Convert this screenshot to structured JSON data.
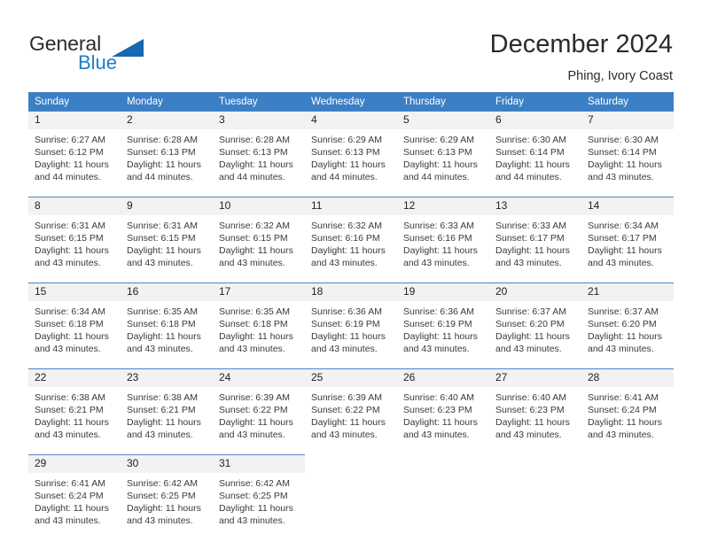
{
  "brand": {
    "name_top": "General",
    "name_bottom": "Blue",
    "triangle_color": "#1669b0",
    "blue_color": "#1f7cc4"
  },
  "header": {
    "title": "December 2024",
    "subtitle": "Phing, Ivory Coast"
  },
  "theme": {
    "header_bg": "#3b7fc4",
    "daynum_bg": "#f2f2f2",
    "row_border": "#4a86c5"
  },
  "calendar": {
    "weekday_headers": [
      "Sunday",
      "Monday",
      "Tuesday",
      "Wednesday",
      "Thursday",
      "Friday",
      "Saturday"
    ],
    "weeks": [
      [
        {
          "day": "1",
          "sunrise": "Sunrise: 6:27 AM",
          "sunset": "Sunset: 6:12 PM",
          "daylight1": "Daylight: 11 hours",
          "daylight2": "and 44 minutes."
        },
        {
          "day": "2",
          "sunrise": "Sunrise: 6:28 AM",
          "sunset": "Sunset: 6:13 PM",
          "daylight1": "Daylight: 11 hours",
          "daylight2": "and 44 minutes."
        },
        {
          "day": "3",
          "sunrise": "Sunrise: 6:28 AM",
          "sunset": "Sunset: 6:13 PM",
          "daylight1": "Daylight: 11 hours",
          "daylight2": "and 44 minutes."
        },
        {
          "day": "4",
          "sunrise": "Sunrise: 6:29 AM",
          "sunset": "Sunset: 6:13 PM",
          "daylight1": "Daylight: 11 hours",
          "daylight2": "and 44 minutes."
        },
        {
          "day": "5",
          "sunrise": "Sunrise: 6:29 AM",
          "sunset": "Sunset: 6:13 PM",
          "daylight1": "Daylight: 11 hours",
          "daylight2": "and 44 minutes."
        },
        {
          "day": "6",
          "sunrise": "Sunrise: 6:30 AM",
          "sunset": "Sunset: 6:14 PM",
          "daylight1": "Daylight: 11 hours",
          "daylight2": "and 44 minutes."
        },
        {
          "day": "7",
          "sunrise": "Sunrise: 6:30 AM",
          "sunset": "Sunset: 6:14 PM",
          "daylight1": "Daylight: 11 hours",
          "daylight2": "and 43 minutes."
        }
      ],
      [
        {
          "day": "8",
          "sunrise": "Sunrise: 6:31 AM",
          "sunset": "Sunset: 6:15 PM",
          "daylight1": "Daylight: 11 hours",
          "daylight2": "and 43 minutes."
        },
        {
          "day": "9",
          "sunrise": "Sunrise: 6:31 AM",
          "sunset": "Sunset: 6:15 PM",
          "daylight1": "Daylight: 11 hours",
          "daylight2": "and 43 minutes."
        },
        {
          "day": "10",
          "sunrise": "Sunrise: 6:32 AM",
          "sunset": "Sunset: 6:15 PM",
          "daylight1": "Daylight: 11 hours",
          "daylight2": "and 43 minutes."
        },
        {
          "day": "11",
          "sunrise": "Sunrise: 6:32 AM",
          "sunset": "Sunset: 6:16 PM",
          "daylight1": "Daylight: 11 hours",
          "daylight2": "and 43 minutes."
        },
        {
          "day": "12",
          "sunrise": "Sunrise: 6:33 AM",
          "sunset": "Sunset: 6:16 PM",
          "daylight1": "Daylight: 11 hours",
          "daylight2": "and 43 minutes."
        },
        {
          "day": "13",
          "sunrise": "Sunrise: 6:33 AM",
          "sunset": "Sunset: 6:17 PM",
          "daylight1": "Daylight: 11 hours",
          "daylight2": "and 43 minutes."
        },
        {
          "day": "14",
          "sunrise": "Sunrise: 6:34 AM",
          "sunset": "Sunset: 6:17 PM",
          "daylight1": "Daylight: 11 hours",
          "daylight2": "and 43 minutes."
        }
      ],
      [
        {
          "day": "15",
          "sunrise": "Sunrise: 6:34 AM",
          "sunset": "Sunset: 6:18 PM",
          "daylight1": "Daylight: 11 hours",
          "daylight2": "and 43 minutes."
        },
        {
          "day": "16",
          "sunrise": "Sunrise: 6:35 AM",
          "sunset": "Sunset: 6:18 PM",
          "daylight1": "Daylight: 11 hours",
          "daylight2": "and 43 minutes."
        },
        {
          "day": "17",
          "sunrise": "Sunrise: 6:35 AM",
          "sunset": "Sunset: 6:18 PM",
          "daylight1": "Daylight: 11 hours",
          "daylight2": "and 43 minutes."
        },
        {
          "day": "18",
          "sunrise": "Sunrise: 6:36 AM",
          "sunset": "Sunset: 6:19 PM",
          "daylight1": "Daylight: 11 hours",
          "daylight2": "and 43 minutes."
        },
        {
          "day": "19",
          "sunrise": "Sunrise: 6:36 AM",
          "sunset": "Sunset: 6:19 PM",
          "daylight1": "Daylight: 11 hours",
          "daylight2": "and 43 minutes."
        },
        {
          "day": "20",
          "sunrise": "Sunrise: 6:37 AM",
          "sunset": "Sunset: 6:20 PM",
          "daylight1": "Daylight: 11 hours",
          "daylight2": "and 43 minutes."
        },
        {
          "day": "21",
          "sunrise": "Sunrise: 6:37 AM",
          "sunset": "Sunset: 6:20 PM",
          "daylight1": "Daylight: 11 hours",
          "daylight2": "and 43 minutes."
        }
      ],
      [
        {
          "day": "22",
          "sunrise": "Sunrise: 6:38 AM",
          "sunset": "Sunset: 6:21 PM",
          "daylight1": "Daylight: 11 hours",
          "daylight2": "and 43 minutes."
        },
        {
          "day": "23",
          "sunrise": "Sunrise: 6:38 AM",
          "sunset": "Sunset: 6:21 PM",
          "daylight1": "Daylight: 11 hours",
          "daylight2": "and 43 minutes."
        },
        {
          "day": "24",
          "sunrise": "Sunrise: 6:39 AM",
          "sunset": "Sunset: 6:22 PM",
          "daylight1": "Daylight: 11 hours",
          "daylight2": "and 43 minutes."
        },
        {
          "day": "25",
          "sunrise": "Sunrise: 6:39 AM",
          "sunset": "Sunset: 6:22 PM",
          "daylight1": "Daylight: 11 hours",
          "daylight2": "and 43 minutes."
        },
        {
          "day": "26",
          "sunrise": "Sunrise: 6:40 AM",
          "sunset": "Sunset: 6:23 PM",
          "daylight1": "Daylight: 11 hours",
          "daylight2": "and 43 minutes."
        },
        {
          "day": "27",
          "sunrise": "Sunrise: 6:40 AM",
          "sunset": "Sunset: 6:23 PM",
          "daylight1": "Daylight: 11 hours",
          "daylight2": "and 43 minutes."
        },
        {
          "day": "28",
          "sunrise": "Sunrise: 6:41 AM",
          "sunset": "Sunset: 6:24 PM",
          "daylight1": "Daylight: 11 hours",
          "daylight2": "and 43 minutes."
        }
      ],
      [
        {
          "day": "29",
          "sunrise": "Sunrise: 6:41 AM",
          "sunset": "Sunset: 6:24 PM",
          "daylight1": "Daylight: 11 hours",
          "daylight2": "and 43 minutes."
        },
        {
          "day": "30",
          "sunrise": "Sunrise: 6:42 AM",
          "sunset": "Sunset: 6:25 PM",
          "daylight1": "Daylight: 11 hours",
          "daylight2": "and 43 minutes."
        },
        {
          "day": "31",
          "sunrise": "Sunrise: 6:42 AM",
          "sunset": "Sunset: 6:25 PM",
          "daylight1": "Daylight: 11 hours",
          "daylight2": "and 43 minutes."
        },
        null,
        null,
        null,
        null
      ]
    ]
  }
}
